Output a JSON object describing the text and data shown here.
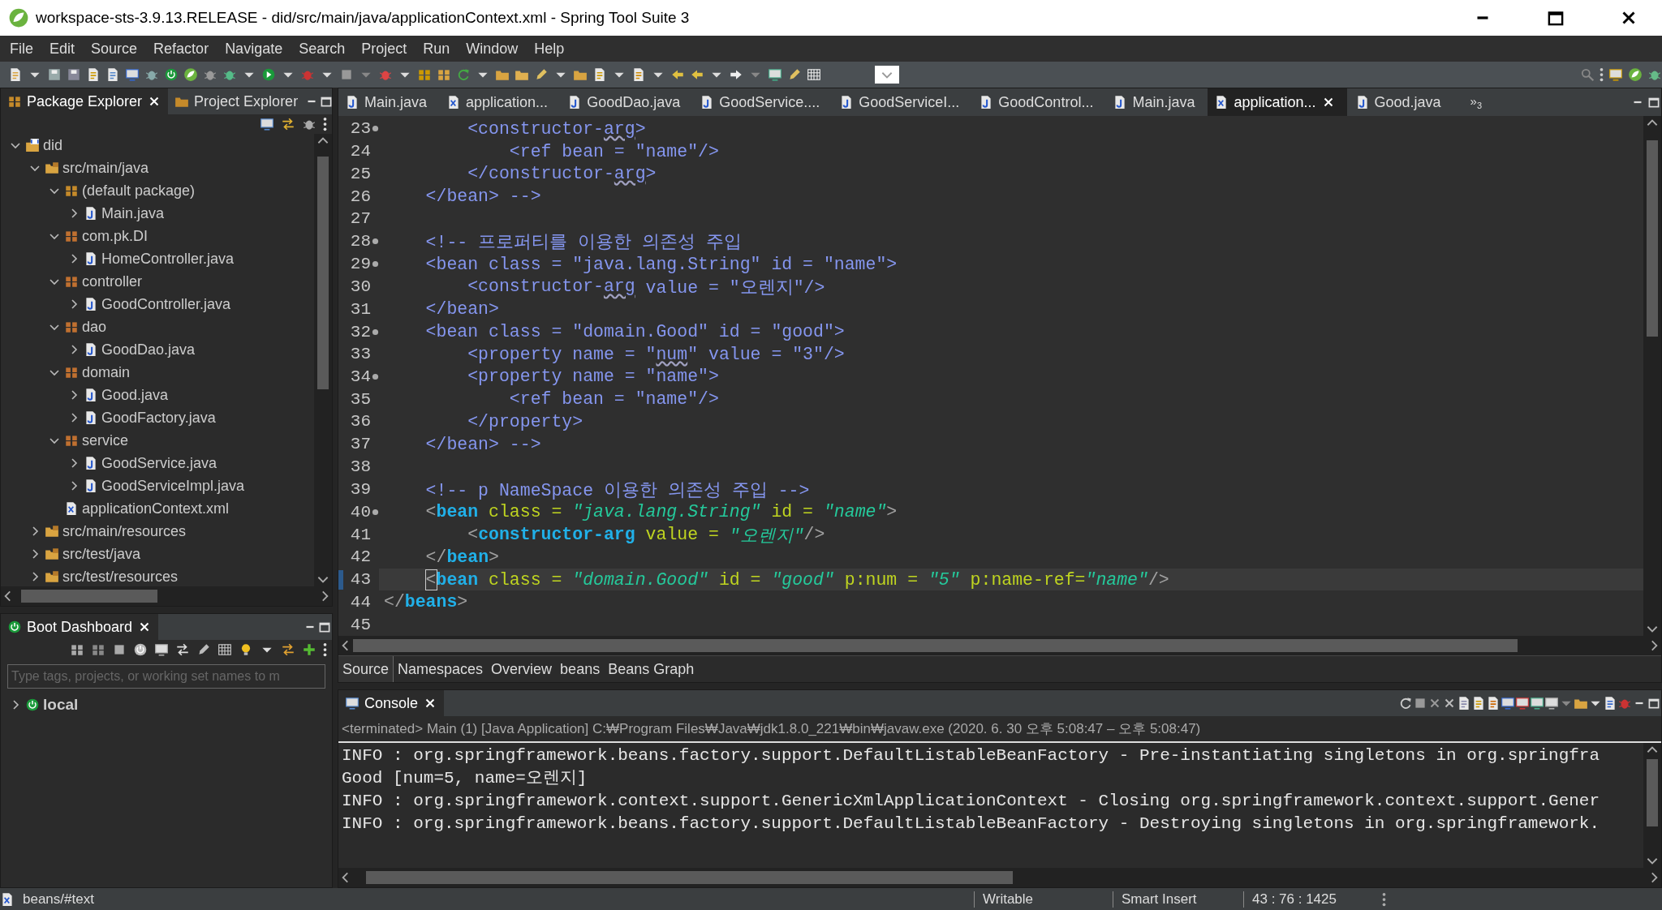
{
  "window": {
    "title": "workspace-sts-3.9.13.RELEASE - did/src/main/java/applicationContext.xml - Spring Tool Suite 3"
  },
  "menu": [
    "File",
    "Edit",
    "Source",
    "Refactor",
    "Navigate",
    "Search",
    "Project",
    "Run",
    "Window",
    "Help"
  ],
  "explorer": {
    "tabs": [
      {
        "label": "Package Explorer",
        "selected": true
      },
      {
        "label": "Project Explorer",
        "selected": false
      }
    ],
    "tree": [
      {
        "label": "did",
        "kind": "project",
        "expanded": true,
        "children": [
          {
            "label": "src/main/java",
            "kind": "source-folder",
            "expanded": true,
            "children": [
              {
                "label": "(default package)",
                "kind": "default-package",
                "expanded": true,
                "children": [
                  {
                    "label": "Main.java",
                    "kind": "java-file",
                    "expanded": false
                  }
                ]
              },
              {
                "label": "com.pk.DI",
                "kind": "package",
                "expanded": true,
                "children": [
                  {
                    "label": "HomeController.java",
                    "kind": "java-file",
                    "expanded": false
                  }
                ]
              },
              {
                "label": "controller",
                "kind": "package",
                "expanded": true,
                "children": [
                  {
                    "label": "GoodController.java",
                    "kind": "java-file",
                    "expanded": false
                  }
                ]
              },
              {
                "label": "dao",
                "kind": "package",
                "expanded": true,
                "children": [
                  {
                    "label": "GoodDao.java",
                    "kind": "java-file",
                    "expanded": false
                  }
                ]
              },
              {
                "label": "domain",
                "kind": "package",
                "expanded": true,
                "children": [
                  {
                    "label": "Good.java",
                    "kind": "java-file",
                    "expanded": false
                  },
                  {
                    "label": "GoodFactory.java",
                    "kind": "java-file",
                    "expanded": false
                  }
                ]
              },
              {
                "label": "service",
                "kind": "package",
                "expanded": true,
                "children": [
                  {
                    "label": "GoodService.java",
                    "kind": "java-file",
                    "expanded": false
                  },
                  {
                    "label": "GoodServiceImpl.java",
                    "kind": "java-file",
                    "expanded": false
                  }
                ]
              },
              {
                "label": "applicationContext.xml",
                "kind": "xml-file"
              }
            ]
          },
          {
            "label": "src/main/resources",
            "kind": "source-folder",
            "expanded": false
          },
          {
            "label": "src/test/java",
            "kind": "source-folder",
            "expanded": false
          },
          {
            "label": "src/test/resources",
            "kind": "source-folder",
            "expanded": false
          }
        ]
      }
    ]
  },
  "boot_dashboard": {
    "title": "Boot Dashboard",
    "search": {
      "placeholder": "Type tags, projects, or working set names to m"
    },
    "items": [
      {
        "label": "local",
        "expanded": false
      }
    ]
  },
  "editor": {
    "tabs": [
      {
        "label": "Main.java",
        "kind": "java",
        "selected": false
      },
      {
        "label": "application...",
        "kind": "xml",
        "selected": false
      },
      {
        "label": "GoodDao.java",
        "kind": "java",
        "selected": false
      },
      {
        "label": "GoodService....",
        "kind": "java",
        "selected": false
      },
      {
        "label": "GoodServiceI...",
        "kind": "java",
        "selected": false
      },
      {
        "label": "GoodControl...",
        "kind": "java",
        "selected": false
      },
      {
        "label": "Main.java",
        "kind": "java",
        "selected": false
      },
      {
        "label": "application...",
        "kind": "xml",
        "selected": true
      },
      {
        "label": "Good.java",
        "kind": "java",
        "selected": false
      }
    ],
    "overflow": {
      "glyph": "»",
      "count": "3"
    },
    "lines": [
      {
        "number": "23",
        "fold": true,
        "current": false,
        "segments": [
          {
            "text": "        <constructor-",
            "kind": "comment"
          },
          {
            "text": "arg",
            "kind": "typo"
          },
          {
            "text": ">",
            "kind": "comment"
          }
        ]
      },
      {
        "number": "24",
        "fold": false,
        "current": false,
        "segments": [
          {
            "text": "            <ref bean = \"name\"/>",
            "kind": "comment"
          }
        ]
      },
      {
        "number": "25",
        "fold": false,
        "current": false,
        "segments": [
          {
            "text": "        </constructor-",
            "kind": "comment"
          },
          {
            "text": "arg",
            "kind": "typo"
          },
          {
            "text": ">",
            "kind": "comment"
          }
        ]
      },
      {
        "number": "26",
        "fold": false,
        "current": false,
        "segments": [
          {
            "text": "    </bean> -->",
            "kind": "comment"
          }
        ]
      },
      {
        "number": "27",
        "fold": false,
        "current": false
      },
      {
        "number": "28",
        "fold": true,
        "current": false,
        "segments": [
          {
            "text": "    <!-- 프로퍼티를 이용한 의존성 주입",
            "kind": "comment"
          }
        ]
      },
      {
        "number": "29",
        "fold": true,
        "current": false,
        "segments": [
          {
            "text": "    <bean class = \"java.lang.String\" id = \"name\">",
            "kind": "comment"
          }
        ]
      },
      {
        "number": "30",
        "fold": false,
        "current": false,
        "segments": [
          {
            "text": "        <constructor-",
            "kind": "comment"
          },
          {
            "text": "arg",
            "kind": "typo"
          },
          {
            "text": " value = \"오렌지\"/>",
            "kind": "comment"
          }
        ]
      },
      {
        "number": "31",
        "fold": false,
        "current": false,
        "segments": [
          {
            "text": "    </bean>",
            "kind": "comment"
          }
        ]
      },
      {
        "number": "32",
        "fold": true,
        "current": false,
        "segments": [
          {
            "text": "    <bean class = \"domain.Good\" id = \"good\">",
            "kind": "comment"
          }
        ]
      },
      {
        "number": "33",
        "fold": false,
        "current": false,
        "segments": [
          {
            "text": "        <property name = \"",
            "kind": "comment"
          },
          {
            "text": "num",
            "kind": "typo"
          },
          {
            "text": "\" value = \"3\"/>",
            "kind": "comment"
          }
        ]
      },
      {
        "number": "34",
        "fold": true,
        "current": false,
        "segments": [
          {
            "text": "        <property name = \"name\">",
            "kind": "comment"
          }
        ]
      },
      {
        "number": "35",
        "fold": false,
        "current": false,
        "segments": [
          {
            "text": "            <ref bean = \"name\"/>",
            "kind": "comment"
          }
        ]
      },
      {
        "number": "36",
        "fold": false,
        "current": false,
        "segments": [
          {
            "text": "        </property>",
            "kind": "comment"
          }
        ]
      },
      {
        "number": "37",
        "fold": false,
        "current": false,
        "segments": [
          {
            "text": "    </bean> -->",
            "kind": "comment"
          }
        ]
      },
      {
        "number": "38",
        "fold": false,
        "current": false
      },
      {
        "number": "39",
        "fold": false,
        "current": false,
        "segments": [
          {
            "text": "    <!-- p NameSpace 이용한 의존성 주입 -->",
            "kind": "comment"
          }
        ]
      },
      {
        "number": "40",
        "fold": true,
        "current": false,
        "segments": [
          {
            "text": "    <",
            "kind": "bracket"
          },
          {
            "text": "bean",
            "kind": "tag"
          },
          {
            "text": " class = ",
            "kind": "attr"
          },
          {
            "text": "\"java.lang.String\"",
            "kind": "value"
          },
          {
            "text": " id = ",
            "kind": "attr"
          },
          {
            "text": "\"name\"",
            "kind": "value"
          },
          {
            "text": ">",
            "kind": "bracket"
          }
        ]
      },
      {
        "number": "41",
        "fold": false,
        "current": false,
        "segments": [
          {
            "text": "        <",
            "kind": "bracket"
          },
          {
            "text": "constructor-arg",
            "kind": "tag"
          },
          {
            "text": " value = ",
            "kind": "attr"
          },
          {
            "text": "\"오렌지\"",
            "kind": "value"
          },
          {
            "text": "/>",
            "kind": "bracket"
          }
        ]
      },
      {
        "number": "42",
        "fold": false,
        "current": false,
        "segments": [
          {
            "text": "    </",
            "kind": "bracket"
          },
          {
            "text": "bean",
            "kind": "tag"
          },
          {
            "text": ">",
            "kind": "bracket"
          }
        ]
      },
      {
        "number": "43",
        "fold": false,
        "current": true,
        "segments": [
          {
            "text": "    <",
            "kind": "caret"
          },
          {
            "text": "bean",
            "kind": "tag"
          },
          {
            "text": " class = ",
            "kind": "attr"
          },
          {
            "text": "\"domain.Good\"",
            "kind": "value"
          },
          {
            "text": " id = ",
            "kind": "attr"
          },
          {
            "text": "\"good\"",
            "kind": "value"
          },
          {
            "text": " p:num = ",
            "kind": "attr"
          },
          {
            "text": "\"5\"",
            "kind": "value"
          },
          {
            "text": " p:name-ref=",
            "kind": "attr"
          },
          {
            "text": "\"name\"",
            "kind": "value"
          },
          {
            "text": "/>",
            "kind": "bracket"
          }
        ]
      },
      {
        "number": "44",
        "fold": false,
        "current": false,
        "segments": [
          {
            "text": "</",
            "kind": "bracket"
          },
          {
            "text": "beans",
            "kind": "tag"
          },
          {
            "text": ">",
            "kind": "bracket"
          }
        ]
      },
      {
        "number": "45",
        "fold": false,
        "current": false
      }
    ],
    "bottom_tabs": [
      {
        "label": "Source",
        "selected": true
      },
      {
        "label": "Namespaces",
        "selected": false
      },
      {
        "label": "Overview",
        "selected": false
      },
      {
        "label": "beans",
        "selected": false
      },
      {
        "label": "Beans Graph",
        "selected": false
      }
    ]
  },
  "console": {
    "title": "Console",
    "header": "<terminated> Main (1) [Java Application] C:₩Program Files₩Java₩jdk1.8.0_221₩bin₩javaw.exe  (2020. 6. 30 오후 5:08:47 – 오후 5:08:47)",
    "output": [
      "INFO : org.springframework.beans.factory.support.DefaultListableBeanFactory - Pre-instantiating singletons in org.springfra",
      "Good [num=5, name=오렌지]",
      "INFO : org.springframework.context.support.GenericXmlApplicationContext - Closing org.springframework.context.support.Gener",
      "INFO : org.springframework.beans.factory.support.DefaultListableBeanFactory - Destroying singletons in org.springframework."
    ]
  },
  "status_bar": {
    "path": "beans/#text",
    "mode": "Writable",
    "insert": "Smart Insert",
    "position": "43 : 76 : 1425"
  }
}
